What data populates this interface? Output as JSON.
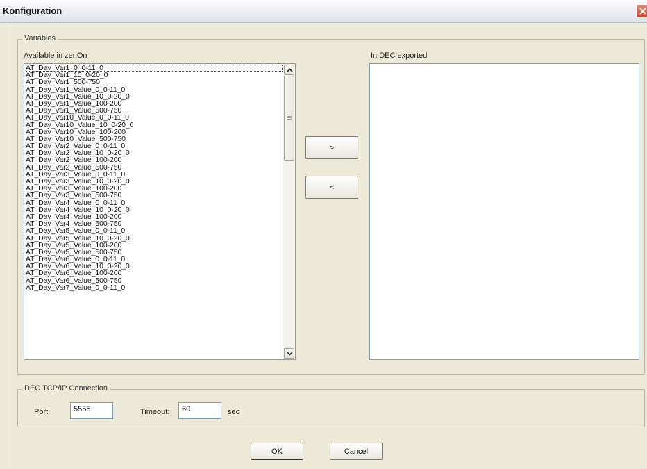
{
  "window": {
    "title": "Konfiguration",
    "close_icon": "close-icon"
  },
  "variables_group": {
    "legend": "Variables",
    "available_label": "Available in zenOn",
    "exported_label": "In DEC exported",
    "available_items": [
      "AT_Day_Var1_0_0-11_0",
      "AT_Day_Var1_10_0-20_0",
      "AT_Day_Var1_500-750",
      "AT_Day_Var1_Value_0_0-11_0",
      "AT_Day_Var1_Value_10_0-20_0",
      "AT_Day_Var1_Value_100-200",
      "AT_Day_Var1_Value_500-750",
      "AT_Day_Var10_Value_0_0-11_0",
      "AT_Day_Var10_Value_10_0-20_0",
      "AT_Day_Var10_Value_100-200",
      "AT_Day_Var10_Value_500-750",
      "AT_Day_Var2_Value_0_0-11_0",
      "AT_Day_Var2_Value_10_0-20_0",
      "AT_Day_Var2_Value_100-200",
      "AT_Day_Var2_Value_500-750",
      "AT_Day_Var3_Value_0_0-11_0",
      "AT_Day_Var3_Value_10_0-20_0",
      "AT_Day_Var3_Value_100-200",
      "AT_Day_Var3_Value_500-750",
      "AT_Day_Var4_Value_0_0-11_0",
      "AT_Day_Var4_Value_10_0-20_0",
      "AT_Day_Var4_Value_100-200",
      "AT_Day_Var4_Value_500-750",
      "AT_Day_Var5_Value_0_0-11_0",
      "AT_Day_Var5_Value_10_0-20_0",
      "AT_Day_Var5_Value_100-200",
      "AT_Day_Var5_Value_500-750",
      "AT_Day_Var6_Value_0_0-11_0",
      "AT_Day_Var6_Value_10_0-20_0",
      "AT_Day_Var6_Value_100-200",
      "AT_Day_Var6_Value_500-750",
      "AT_Day_Var7_Value_0_0-11_0"
    ],
    "exported_items": [],
    "add_button": ">",
    "remove_button": "<"
  },
  "connection_group": {
    "legend": "DEC TCP/IP Connection",
    "port_label": "Port:",
    "port_value": "5555",
    "timeout_label": "Timeout:",
    "timeout_value": "60",
    "timeout_unit": "sec"
  },
  "buttons": {
    "ok": "OK",
    "cancel": "Cancel"
  }
}
